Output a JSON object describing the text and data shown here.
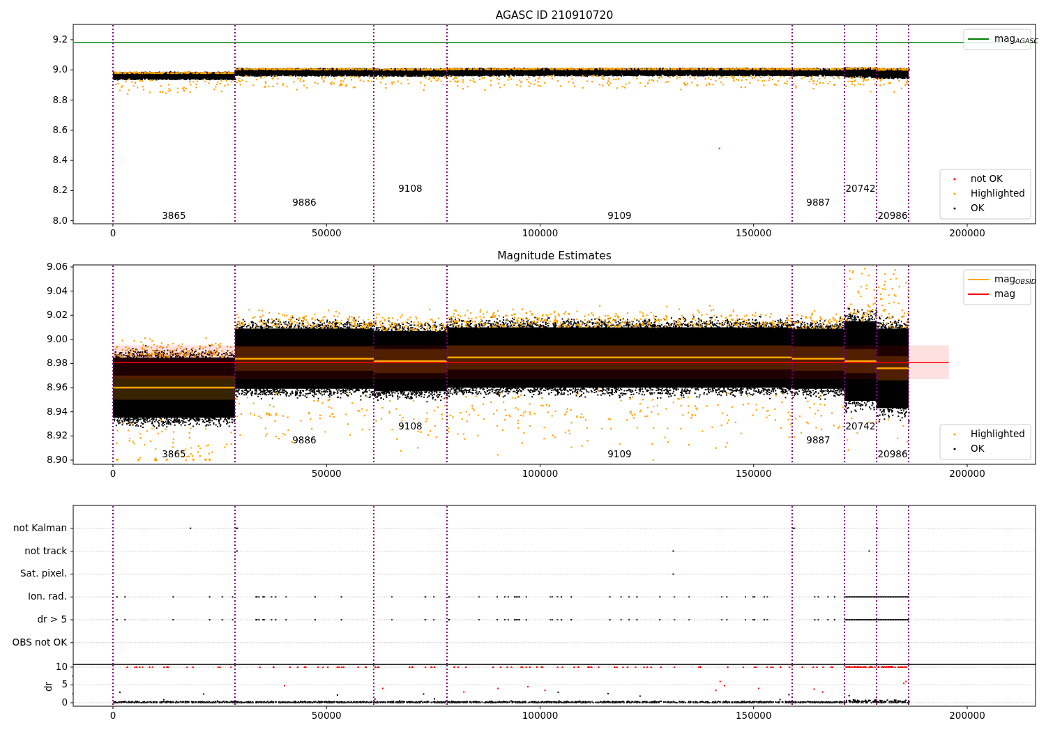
{
  "figure": {
    "panels": [
      {
        "kind": "agasc",
        "title": "AGASC ID 210910720",
        "yticks": [
          "9.2",
          "9.0",
          "8.8",
          "8.6",
          "8.4",
          "8.2",
          "8.0"
        ],
        "xticks": [
          "0",
          "50000",
          "100000",
          "150000",
          "200000"
        ],
        "region_labels": [
          "3865",
          "9886",
          "9108",
          "9109",
          "9887",
          "20742",
          "20986"
        ],
        "legend_upper": [
          {
            "kind": "line",
            "label": "mag",
            "subscript": "AGASC",
            "color": "#008000"
          }
        ],
        "legend_lower": [
          {
            "kind": "dot",
            "label": "not OK",
            "color": "#ff0000"
          },
          {
            "kind": "dot",
            "label": "Highlighted",
            "color": "#ffa500"
          },
          {
            "kind": "dot",
            "label": "OK",
            "color": "#000000"
          }
        ]
      },
      {
        "kind": "estimates",
        "title": "Magnitude Estimates",
        "yticks": [
          "9.06",
          "9.04",
          "9.02",
          "9.00",
          "8.98",
          "8.96",
          "8.94",
          "8.92",
          "8.90"
        ],
        "xticks": [
          "0",
          "50000",
          "100000",
          "150000",
          "200000"
        ],
        "region_labels": [
          "3865",
          "9886",
          "9108",
          "9109",
          "9887",
          "20742",
          "20986"
        ],
        "legend_upper": [
          {
            "kind": "line",
            "label": "mag",
            "subscript": "OBSID",
            "color": "#ffa500"
          },
          {
            "kind": "line",
            "label": "mag",
            "color": "#ff0000"
          }
        ],
        "legend_lower": [
          {
            "kind": "dot",
            "label": "Highlighted",
            "color": "#ffa500"
          },
          {
            "kind": "dot",
            "label": "OK",
            "color": "#000000"
          }
        ]
      },
      {
        "kind": "flags",
        "categories": [
          "not Kalman",
          "not track",
          "Sat. pixel.",
          "Ion. rad.",
          "dr > 5",
          "OBS not OK"
        ]
      },
      {
        "kind": "dr",
        "ylabel": "dr",
        "yticks": [
          "10",
          "5",
          "0"
        ],
        "xticks": [
          "0",
          "50000",
          "100000",
          "150000",
          "200000"
        ]
      }
    ]
  }
}
